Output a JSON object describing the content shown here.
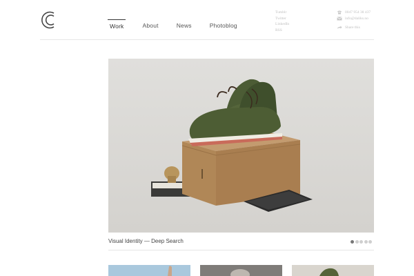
{
  "header": {
    "logo_icon": "cc-logo-icon",
    "nav": [
      {
        "label": "Work",
        "active": true
      },
      {
        "label": "About",
        "active": false
      },
      {
        "label": "News",
        "active": false
      },
      {
        "label": "Photoblog",
        "active": false
      }
    ],
    "social": [
      "Tumblr",
      "Twitter",
      "LinkedIn",
      "RSS"
    ],
    "contact": {
      "phone": "0047 954 38 437",
      "email": "info@daliks.no",
      "share": "Share this"
    }
  },
  "slideshow": {
    "caption": "Visual Identity — Deep Search",
    "slide_count": 5,
    "active_index": 0
  },
  "thumbnails": [
    {
      "icon": "project-thumbnail-icon"
    },
    {
      "icon": "project-thumbnail-icon"
    },
    {
      "icon": "project-thumbnail-icon"
    }
  ],
  "colors": {
    "accent": "#333333",
    "muted": "#c0c0c0",
    "hero_bg": "#dcdad7",
    "boot_green": "#4a5a33",
    "box_kraft": "#b8926a"
  }
}
